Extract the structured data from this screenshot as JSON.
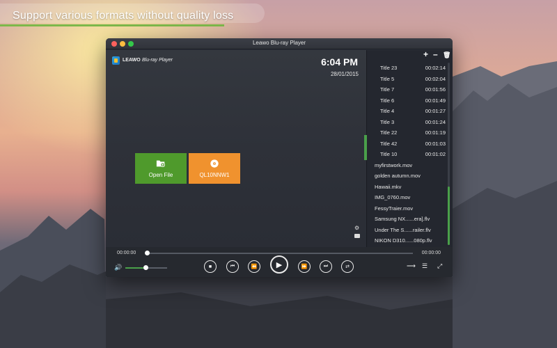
{
  "banner": {
    "text": "Support various formats without quality loss"
  },
  "window": {
    "title": "Leawo Blu-ray Player"
  },
  "brand": {
    "name": "LEAWO",
    "product": "Blu-ray Player"
  },
  "status": {
    "time": "6:04 PM",
    "date": "28/01/2015"
  },
  "tiles": [
    {
      "label": "Open File",
      "icon": "folder-add-icon",
      "color": "#4f9a2c"
    },
    {
      "label": "QL10NNW1",
      "icon": "disc-icon",
      "color": "#f0922e"
    }
  ],
  "playlist": {
    "titles": [
      {
        "name": "Title 23",
        "duration": "00:02:14"
      },
      {
        "name": "Title 5",
        "duration": "00:02:04"
      },
      {
        "name": "Title 7",
        "duration": "00:01:56"
      },
      {
        "name": "Title 6",
        "duration": "00:01:49"
      },
      {
        "name": "Title 4",
        "duration": "00:01:27"
      },
      {
        "name": "Title 3",
        "duration": "00:01:24"
      },
      {
        "name": "Title 22",
        "duration": "00:01:19"
      },
      {
        "name": "Title 42",
        "duration": "00:01:03"
      },
      {
        "name": "Title 10",
        "duration": "00:01:02"
      }
    ],
    "files": [
      {
        "name": "myfirstwork.mov"
      },
      {
        "name": "golden autumn.mov"
      },
      {
        "name": "Hawaii.mkv"
      },
      {
        "name": "IMG_0760.mov"
      },
      {
        "name": "FessyTraier.mov"
      },
      {
        "name": "Samsung NX......era].flv"
      },
      {
        "name": "Under The S......railer.flv"
      },
      {
        "name": "NIKON D310......080p.flv"
      }
    ]
  },
  "player": {
    "current_time": "00:00:00",
    "total_time": "00:00:00",
    "volume_level": 0.48
  },
  "colors": {
    "accent": "#4aa04a",
    "open_tile": "#4f9a2c",
    "disc_tile": "#f0922e"
  }
}
